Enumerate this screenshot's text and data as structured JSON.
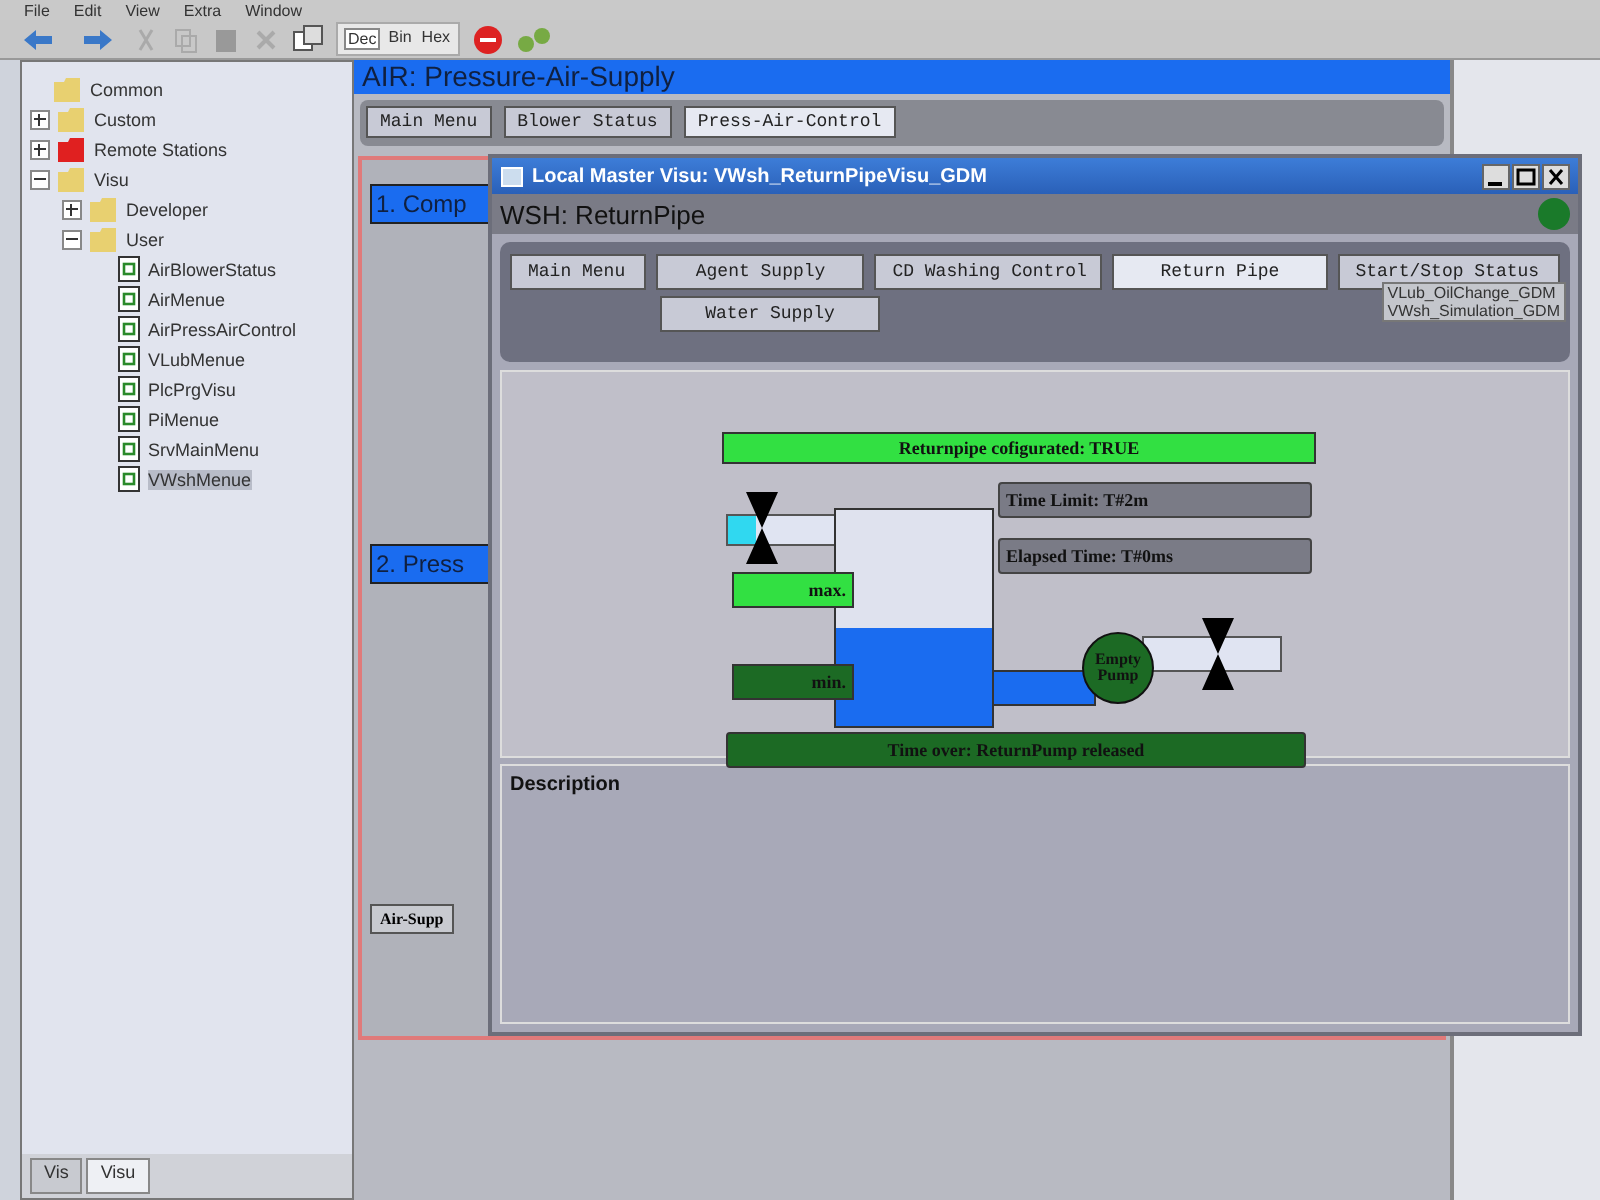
{
  "menu": [
    "File",
    "Edit",
    "View",
    "Extra",
    "Window"
  ],
  "number_modes": [
    {
      "label": "Dec",
      "selected": true
    },
    {
      "label": "Bin",
      "selected": false
    },
    {
      "label": "Hex",
      "selected": false
    }
  ],
  "tree": [
    {
      "label": "Common",
      "kind": "folder"
    },
    {
      "label": "Custom",
      "kind": "folder",
      "expanded": false
    },
    {
      "label": "Remote Stations",
      "kind": "remote",
      "expanded": false
    },
    {
      "label": "Visu",
      "kind": "folder",
      "expanded": true,
      "children": [
        {
          "label": "Developer",
          "kind": "folder",
          "expanded": false
        },
        {
          "label": "User",
          "kind": "folder",
          "expanded": true,
          "children": [
            {
              "label": "AirBlowerStatus",
              "kind": "visu",
              "selected": false
            },
            {
              "label": "AirMenue",
              "kind": "visu",
              "selected": false
            },
            {
              "label": "AirPressAirControl",
              "kind": "visu",
              "selected": false
            },
            {
              "label": "VLubMenue",
              "kind": "visu",
              "selected": false
            },
            {
              "label": "PlcPrgVisu",
              "kind": "visu",
              "selected": false
            },
            {
              "label": "PiMenue",
              "kind": "visu",
              "selected": false
            },
            {
              "label": "SrvMainMenu",
              "kind": "visu",
              "selected": false
            },
            {
              "label": "VWshMenue",
              "kind": "visu",
              "selected": true
            }
          ]
        }
      ]
    }
  ],
  "left_tabs": [
    {
      "label": "Vis",
      "selected": false
    },
    {
      "label": "Visu",
      "selected": true
    }
  ],
  "air_panel": {
    "title": "AIR:  Pressure-Air-Supply",
    "tabs": [
      {
        "label": "Main Menu",
        "selected": false
      },
      {
        "label": "Blower Status",
        "selected": false
      },
      {
        "label": "Press-Air-Control",
        "selected": true
      }
    ],
    "sections": [
      "1. Comp",
      "2. Press"
    ],
    "buttons": [
      "Air-Supp"
    ]
  },
  "window": {
    "title": "Local Master Visu: VWsh_ReturnPipeVisu_GDM",
    "header": "WSH: ReturnPipe",
    "nav": [
      {
        "label": "Main Menu",
        "selected": false
      },
      {
        "label": "Agent Supply",
        "selected": false
      },
      {
        "label": "CD Washing Control",
        "selected": false
      },
      {
        "label": "Return Pipe",
        "selected": true
      },
      {
        "label": "Start/Stop Status",
        "selected": false
      },
      {
        "label": "Water Supply",
        "selected": false
      }
    ],
    "popup": [
      "VLub_OilChange_GDM",
      "VWsh_Simulation_GDM"
    ],
    "diagram": {
      "config_status": {
        "text": "Returnpipe cofigurated: TRUE",
        "on": true
      },
      "time_limit": "Time Limit: T#2m",
      "elapsed": "Elapsed Time: T#0ms",
      "max": {
        "label": "max.",
        "on": true
      },
      "min": {
        "label": "min.",
        "on": false
      },
      "tank": {
        "level": 0.45
      },
      "pump": {
        "label": "Empty Pump",
        "on": false
      },
      "message": {
        "text": "Time over: ReturnPump released",
        "on": false
      }
    },
    "description_label": "Description"
  }
}
